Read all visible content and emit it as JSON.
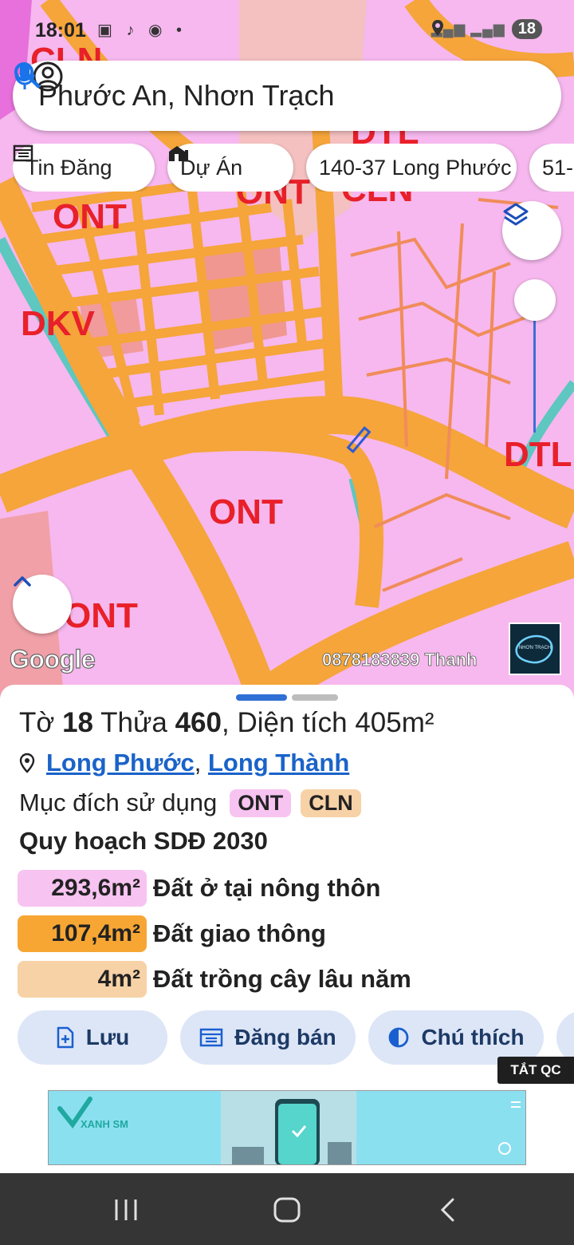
{
  "status_bar": {
    "time": "18:01",
    "notification_icons": "▣ ♪ ◉ •",
    "battery": "18"
  },
  "search": {
    "query": "Phước An, Nhơn Trạch"
  },
  "chips": [
    {
      "label": "Tin Đăng",
      "icon": "listing-icon"
    },
    {
      "label": "Dự Án",
      "icon": "building-icon"
    },
    {
      "label": "140-37 Long Phước",
      "icon": ""
    },
    {
      "label": "51-",
      "icon": ""
    }
  ],
  "map": {
    "zone_labels": [
      "CLN",
      "DTL",
      "CLN",
      "ONT",
      "ONT",
      "DKV",
      "DTL",
      "ONT",
      "ONT"
    ],
    "google_logo": "Google",
    "watermark": "0878183839 Thanh",
    "thumbnail_text": "NHƠN TRẠCH",
    "colors": {
      "residential": "#f6b8ee",
      "road": "#f5a53a",
      "perennial": "#f2c79a",
      "water": "#5ec7c0",
      "label": "#e8202a"
    }
  },
  "parcel": {
    "sheet_label": "Tờ",
    "sheet_no": "18",
    "plot_label": "Thửa",
    "plot_no": "460",
    "area_label": "Diện tích",
    "area": "405m²",
    "commune": "Long Phước",
    "separator": ",",
    "district": "Long Thành",
    "purpose_label": "Mục đích sử dụng",
    "purpose_tags": [
      {
        "code": "ONT",
        "color": "#f7c3f1"
      },
      {
        "code": "CLN",
        "color": "#f7d2a6"
      }
    ],
    "plan_title": "Quy hoạch SDĐ 2030",
    "plan_areas": [
      {
        "value": "293,6m²",
        "label": "Đất ở tại nông thôn",
        "color": "#f7c3f1"
      },
      {
        "value": "107,4m²",
        "label": "Đất giao thông",
        "color": "#f7a634"
      },
      {
        "value": "4m²",
        "label": "Đất trồng cây lâu năm",
        "color": "#f7d2a6"
      }
    ]
  },
  "actions": [
    {
      "label": "Lưu",
      "icon": "save-icon"
    },
    {
      "label": "Đăng bán",
      "icon": "post-icon"
    },
    {
      "label": "Chú thích",
      "icon": "legend-icon"
    }
  ],
  "ad": {
    "off_label": "TẮT QC",
    "brand": "XANH SM"
  }
}
